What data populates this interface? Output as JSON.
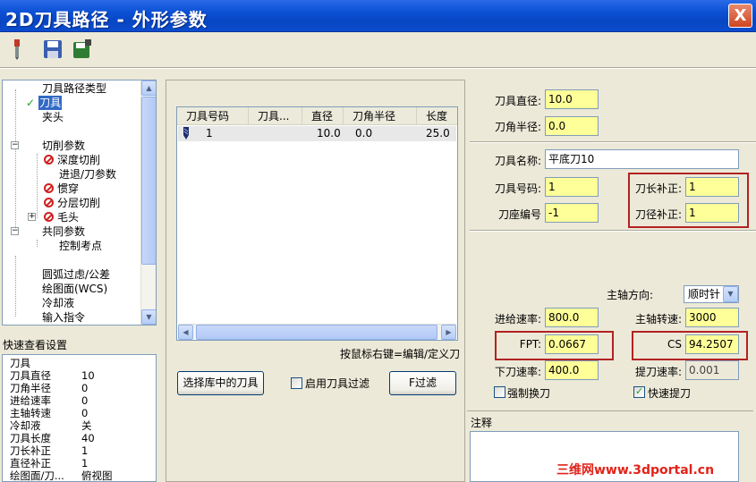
{
  "window": {
    "title": "2D刀具路径 - 外形参数",
    "close_label": "X"
  },
  "toolbar": {
    "buttons": [
      {
        "name": "tool-icon"
      },
      {
        "name": "save-icon"
      },
      {
        "name": "save-library-icon"
      }
    ]
  },
  "tree": {
    "items": [
      {
        "label": "刀具路径类型",
        "icon": null
      },
      {
        "label": "刀具",
        "icon": "checkmark-icon",
        "selected": true
      },
      {
        "label": "夹头",
        "icon": null
      },
      {
        "label": "切削参数",
        "icon": null
      },
      {
        "label": "深度切削",
        "icon": "disabled-icon"
      },
      {
        "label": "进退/刀参数",
        "icon": null
      },
      {
        "label": "惯穿",
        "icon": "disabled-icon"
      },
      {
        "label": "分层切削",
        "icon": "disabled-icon"
      },
      {
        "label": "毛头",
        "icon": "disabled-icon"
      },
      {
        "label": "共同参数",
        "icon": null
      },
      {
        "label": "控制考点",
        "icon": null
      },
      {
        "label": "圆弧过虑/公差",
        "icon": null
      },
      {
        "label": "绘图面(WCS)",
        "icon": null
      },
      {
        "label": "冷却液",
        "icon": null
      },
      {
        "label": "输入指令",
        "icon": null
      }
    ]
  },
  "quick_view": {
    "title": "快速查看设置",
    "rows": [
      {
        "k": "刀具",
        "v": ""
      },
      {
        "k": "刀具直径",
        "v": "10"
      },
      {
        "k": "刀角半径",
        "v": "0"
      },
      {
        "k": "进给速率",
        "v": "0"
      },
      {
        "k": "主轴转速",
        "v": "0"
      },
      {
        "k": "冷却液",
        "v": "关"
      },
      {
        "k": "刀具长度",
        "v": "40"
      },
      {
        "k": "刀长补正",
        "v": "1"
      },
      {
        "k": "直径补正",
        "v": "1"
      },
      {
        "k": "绘图面/刀...",
        "v": "俯视图"
      }
    ]
  },
  "tool_list": {
    "columns": [
      "刀具号码",
      "刀具...",
      "直径",
      "刀角半径",
      "长度"
    ],
    "rows": [
      {
        "num": "1",
        "name": "",
        "dia": "10.0",
        "radius": "0.0",
        "len": "25.0"
      }
    ],
    "hint": "按鼠标右键=编辑/定义刀"
  },
  "buttons": {
    "select_library": "选择库中的刀具",
    "enable_filter": "启用刀具过滤",
    "filter": "F过滤"
  },
  "params": {
    "tool_diameter": {
      "label": "刀具直径:",
      "value": "10.0"
    },
    "corner_radius": {
      "label": "刀角半径:",
      "value": "0.0"
    },
    "tool_name": {
      "label": "刀具名称:",
      "value": "平底刀10"
    },
    "tool_number": {
      "label": "刀具号码:",
      "value": "1"
    },
    "length_offset": {
      "label": "刀长补正:",
      "value": "1"
    },
    "holder_number": {
      "label": "刀座编号",
      "value": "-1"
    },
    "dia_offset": {
      "label": "刀径补正:",
      "value": "1"
    },
    "spindle_dir": {
      "label": "主轴方向:",
      "value": "顺时针"
    },
    "feed_rate": {
      "label": "进给速率:",
      "value": "800.0"
    },
    "spindle_speed": {
      "label": "主轴转速:",
      "value": "3000"
    },
    "fpt": {
      "label": "FPT:",
      "value": "0.0667"
    },
    "cs": {
      "label": "CS",
      "value": "94.2507"
    },
    "plunge_rate": {
      "label": "下刀速率:",
      "value": "400.0"
    },
    "retract_rate": {
      "label": "提刀速率:",
      "value": "0.001"
    },
    "force_tool_change": {
      "label": "强制换刀",
      "checked": false
    },
    "rapid_retract": {
      "label": "快速提刀",
      "checked": true
    },
    "notes_label": "注释"
  },
  "watermark": "三维网www.3dportal.cn",
  "colors": {
    "title_bar": "#0a4fd4",
    "field_yellow": "#ffff99",
    "highlight": "#316ac5",
    "annotation_red": "#b22222"
  }
}
